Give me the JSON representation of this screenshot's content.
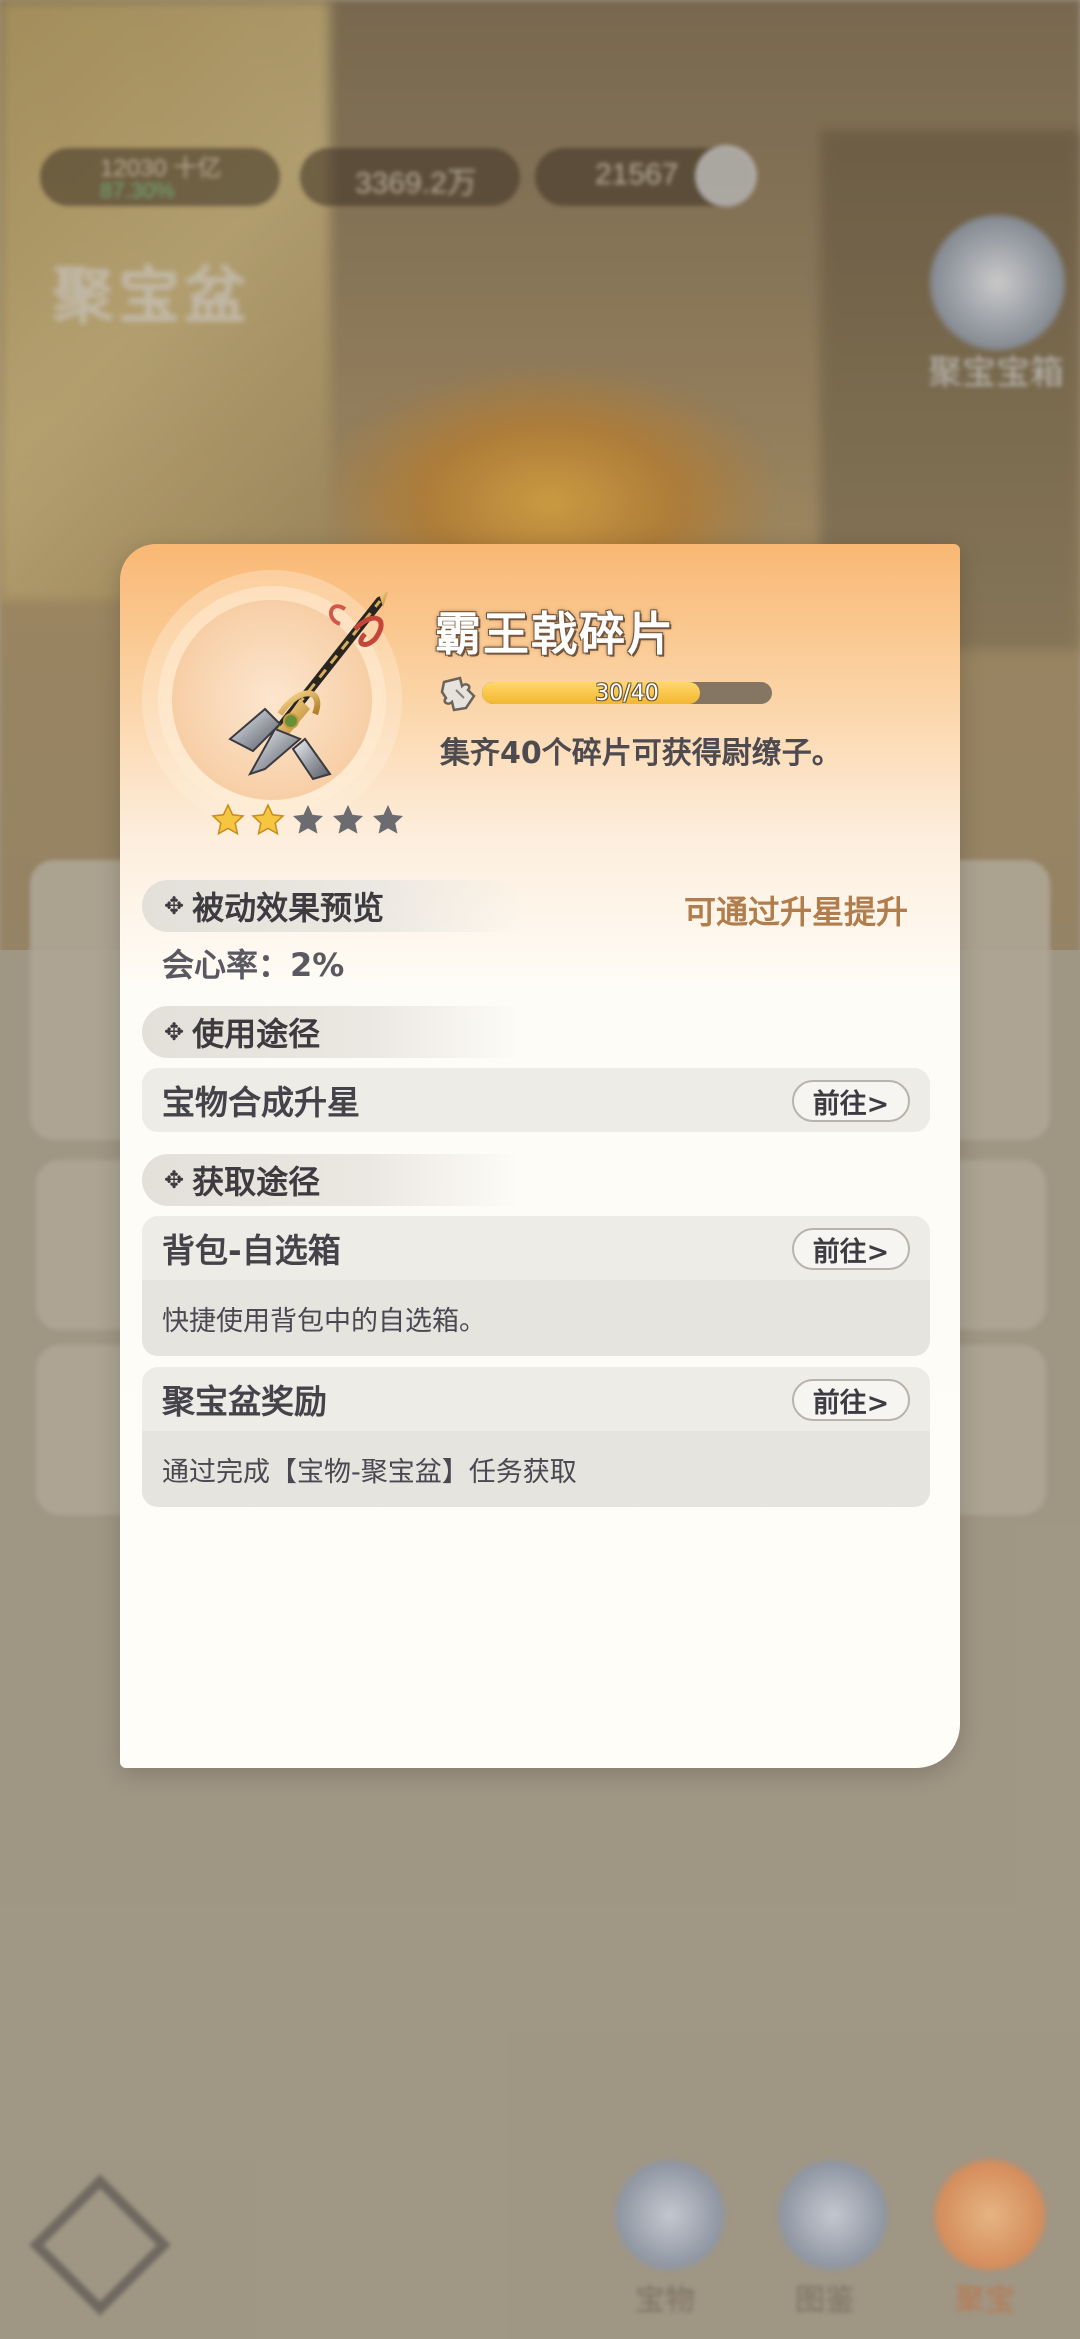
{
  "background": {
    "top_bar": {
      "resource_1": "12030 十亿",
      "resource_1_sub": "87.30%",
      "resource_2": "3369.2万",
      "resource_3": "21567"
    },
    "page_title": "聚宝盆",
    "right_badge_label": "聚宝宝箱",
    "bottom_nav": [
      "宝物",
      "图鉴",
      "聚宝"
    ]
  },
  "item": {
    "name": "霸王戟碎片",
    "progress_current": 30,
    "progress_total": 40,
    "progress_text": "30/40",
    "description": "集齐40个碎片可获得尉缭子。",
    "stars_filled": 2,
    "stars_total": 5,
    "icon": "halberd-icon"
  },
  "passive": {
    "header": "被动效果预览",
    "hint": "可通过升星提升",
    "effect": "会心率：2%"
  },
  "usage": {
    "header": "使用途径",
    "rows": [
      {
        "title": "宝物合成升星",
        "button": "前往>"
      }
    ]
  },
  "acquire": {
    "header": "获取途径",
    "rows": [
      {
        "title": "背包-自选箱",
        "button": "前往>",
        "desc": "快捷使用背包中的自选箱。"
      },
      {
        "title": "聚宝盆奖励",
        "button": "前往>",
        "desc": "通过完成【宝物-聚宝盆】任务获取"
      }
    ]
  },
  "colors": {
    "panel_top": "#f9b874",
    "accent_text": "#b27d4d",
    "progress_fill": "#f3b730"
  }
}
